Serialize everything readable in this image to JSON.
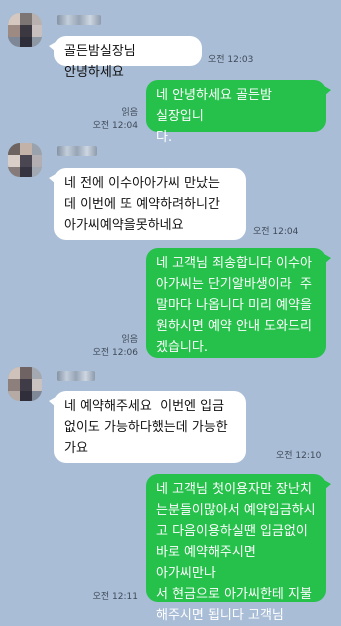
{
  "messages": [
    {
      "sender": "them",
      "text": "골든밤실장님 안녕하세요",
      "time": "오전 12:03"
    },
    {
      "sender": "me",
      "text": "네 안녕하세요 골든밤 실장입니\n다.",
      "read": "읽음",
      "time": "오전 12:04"
    },
    {
      "sender": "them",
      "text": "네 전에 이수아아가씨 만났는\n데 이번에 또 예약하려하니간\n아가씨예약을못하네요",
      "time": "오전 12:04"
    },
    {
      "sender": "me",
      "text": "네 고객님 죄송합니다 이수아\n아가씨는 단기알바생이라  주\n말마다 나옵니다 미리 예약을\n원하시면 예약 안내 도와드리\n겠습니다.",
      "read": "읽음",
      "time": "오전 12:06"
    },
    {
      "sender": "them",
      "text": "네 예약해주세요  이번엔 입금\n없이도 가능하다했는데 가능한\n가요",
      "time": "오전 12:10"
    },
    {
      "sender": "me",
      "text": "네 고객님 첫이용자만 장난치\n는분들이많아서 예약입금하시\n고 다음이용하실땐 입금없이\n바로 예약해주시면 아가씨만나\n서 현금으로 아가씨한테 지불\n해주시면 됩니다 고객님",
      "read": "",
      "time": "오전 12:11"
    }
  ]
}
